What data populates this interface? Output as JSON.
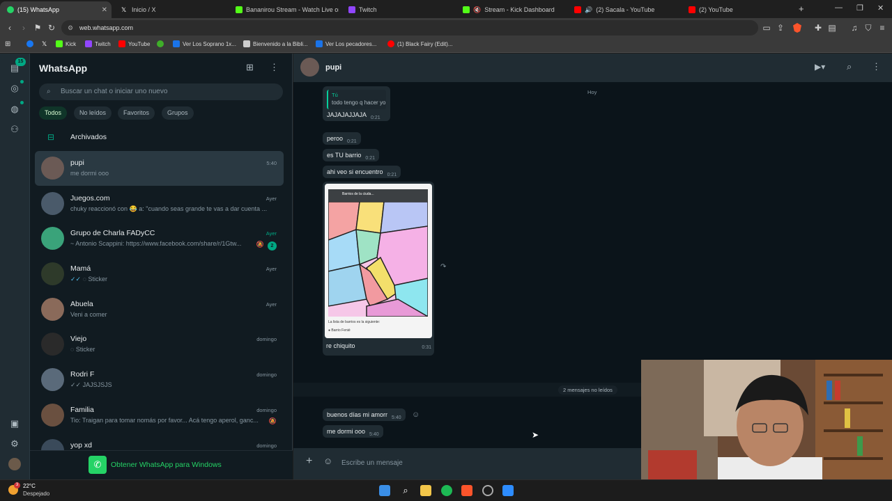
{
  "browser": {
    "tabs": [
      {
        "label": "(15) WhatsApp",
        "color": "#25d366",
        "active": true
      },
      {
        "label": "Inicio / X",
        "color": "#ffffff"
      },
      {
        "label": "Bananirou Stream - Watch Live on Ki",
        "color": "#53fc18"
      },
      {
        "label": "Twitch",
        "color": "#9146ff"
      },
      {
        "label": "Stream - Kick Dashboard",
        "color": "#53fc18"
      },
      {
        "label": "(2) Sacala - YouTube",
        "color": "#ff0000"
      },
      {
        "label": "(2) YouTube",
        "color": "#ff0000"
      }
    ],
    "new_tab": "+",
    "url": "web.whatsapp.com",
    "bookmarks": [
      {
        "label": "",
        "color": "#1877f2"
      },
      {
        "label": "",
        "color": "#ffffff"
      },
      {
        "label": "Kick",
        "color": "#53fc18"
      },
      {
        "label": "Twitch",
        "color": "#9146ff"
      },
      {
        "label": "YouTube",
        "color": "#ff0000"
      },
      {
        "label": "",
        "color": "#3fae29"
      },
      {
        "label": "Ver Los Soprano 1x...",
        "color": "#1a73e8"
      },
      {
        "label": "Bienvenido a la Bibli...",
        "color": "#cccccc"
      },
      {
        "label": "Ver Los pecadores...",
        "color": "#1a73e8"
      },
      {
        "label": "(1) Black Fairy (Edit)...",
        "color": "#ff0000"
      }
    ]
  },
  "rail": {
    "chats_badge": "15"
  },
  "sidebar": {
    "title": "WhatsApp",
    "search_placeholder": "Buscar un chat o iniciar uno nuevo",
    "filters": [
      "Todos",
      "No leídos",
      "Favoritos",
      "Grupos"
    ],
    "archived_label": "Archivados",
    "chats": [
      {
        "name": "pupi",
        "message": "me dormi ooo",
        "time": "5:40",
        "active": true,
        "avatar_color": "#6b5a55"
      },
      {
        "name": "Juegos.com",
        "message": "chuky reaccionó con 😂 a: \"cuando seas grande te vas a dar cuenta ...",
        "time": "Ayer",
        "avatar_color": "#4a5a6a"
      },
      {
        "name": "Grupo de Charla FADyCC",
        "message": "~ Antonio Scappini: https://www.facebook.com/share/r/1Gtw...",
        "time": "Ayer",
        "time_green": true,
        "unread": "2",
        "muted": true,
        "avatar_color": "#3aa37a"
      },
      {
        "name": "Mamá",
        "message": "Sticker",
        "time": "Ayer",
        "avatar_color": "#2e3a2a"
      },
      {
        "name": "Abuela",
        "message": "Veni a comer",
        "time": "Ayer",
        "avatar_color": "#8a6a5a"
      },
      {
        "name": "Viejo",
        "message": "Sticker",
        "time": "domingo",
        "avatar_color": "#2a2a2a"
      },
      {
        "name": "Rodri F",
        "message": "JAJSJSJS",
        "time": "domingo",
        "avatar_color": "#5a6a7a"
      },
      {
        "name": "Familia",
        "message": "Tio: Traigan para tomar nomás por favor... Acá tengo aperol, ganc...",
        "time": "domingo",
        "muted": true,
        "avatar_color": "#6a5040"
      },
      {
        "name": "yop xd",
        "message": "",
        "time": "domingo",
        "avatar_color": "#3a4a5a"
      }
    ],
    "get_windows": "Obtener WhatsApp para Windows"
  },
  "chat": {
    "contact": "pupi",
    "date_divider": "Hoy",
    "quote": {
      "author": "Tú",
      "text": "todo tengo q hacer yo"
    },
    "messages": [
      {
        "text": "JAJAJAJJAJA",
        "time": "0:21"
      },
      {
        "text": "peroo",
        "time": "0:21"
      },
      {
        "text": "es TU barrio",
        "time": "0:21"
      },
      {
        "text": "ahi veo si encuentro",
        "time": "0:21"
      }
    ],
    "image_message": {
      "caption": "re chiquito",
      "time": "0:31",
      "map_title": "Barrios de la ciuda...",
      "map_footer": "La lista de barrios es la siguiente:",
      "map_item": "Barrio Fenié"
    },
    "unread_divider": "2 mensajes no leídos",
    "new_messages": [
      {
        "text": "buenos días mi amorr",
        "time": "5:40"
      },
      {
        "text": "me dormi ooo",
        "time": "5:40"
      }
    ],
    "composer_placeholder": "Escribe un mensaje"
  },
  "taskbar": {
    "temperature": "22°C",
    "weather": "Despejado",
    "weather_badge": "3"
  }
}
